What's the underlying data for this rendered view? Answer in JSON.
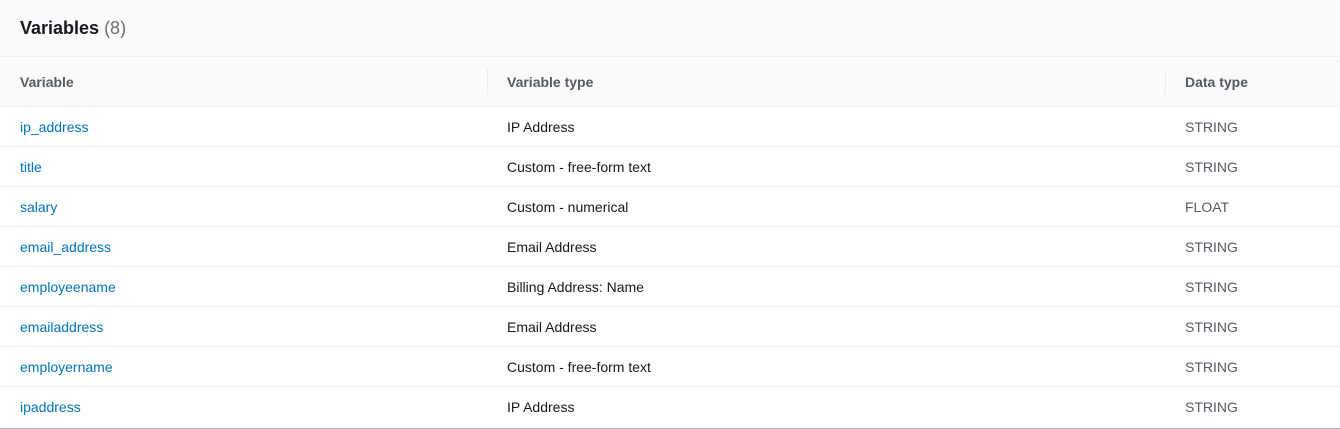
{
  "panel": {
    "title": "Variables",
    "count": "(8)"
  },
  "columns": {
    "variable": "Variable",
    "variable_type": "Variable type",
    "data_type": "Data type"
  },
  "rows": [
    {
      "variable": "ip_address",
      "variable_type": "IP Address",
      "data_type": "STRING"
    },
    {
      "variable": "title",
      "variable_type": "Custom - free-form text",
      "data_type": "STRING"
    },
    {
      "variable": "salary",
      "variable_type": "Custom - numerical",
      "data_type": "FLOAT"
    },
    {
      "variable": "email_address",
      "variable_type": "Email Address",
      "data_type": "STRING"
    },
    {
      "variable": "employeename",
      "variable_type": "Billing Address: Name",
      "data_type": "STRING"
    },
    {
      "variable": "emailaddress",
      "variable_type": "Email Address",
      "data_type": "STRING"
    },
    {
      "variable": "employername",
      "variable_type": "Custom - free-form text",
      "data_type": "STRING"
    },
    {
      "variable": "ipaddress",
      "variable_type": "IP Address",
      "data_type": "STRING"
    }
  ],
  "colors": {
    "link": "#0073bb",
    "header_bg": "#fafafa",
    "border": "#eaeded",
    "muted_text": "#545b64"
  }
}
